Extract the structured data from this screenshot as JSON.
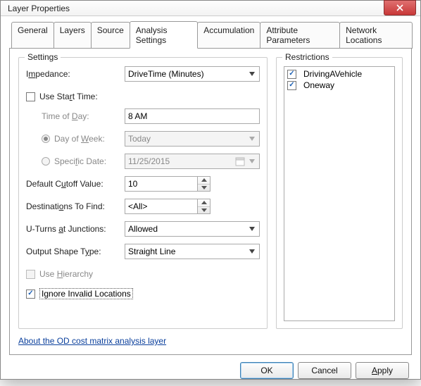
{
  "window": {
    "title": "Layer Properties"
  },
  "tabs": {
    "items": [
      {
        "label": "General"
      },
      {
        "label": "Layers"
      },
      {
        "label": "Source"
      },
      {
        "label": "Analysis Settings"
      },
      {
        "label": "Accumulation"
      },
      {
        "label": "Attribute Parameters"
      },
      {
        "label": "Network Locations"
      }
    ],
    "active_index": 3
  },
  "settings": {
    "legend": "Settings",
    "impedance": {
      "label_pre": "I",
      "label_u": "m",
      "label_post": "pedance:",
      "value": "DriveTime (Minutes)"
    },
    "use_start_time": {
      "label_pre": "Use Sta",
      "label_u": "r",
      "label_post": "t Time:",
      "checked": false
    },
    "time_of_day": {
      "label_pre": "Time of ",
      "label_u": "D",
      "label_post": "ay:",
      "value": "8 AM"
    },
    "day_of_week": {
      "label_pre": "Day of ",
      "label_u": "W",
      "label_post": "eek:",
      "value": "Today",
      "selected": true
    },
    "specific_date": {
      "label_pre": "Speci",
      "label_u": "f",
      "label_post": "ic Date:",
      "value": "11/25/2015",
      "selected": false
    },
    "cutoff": {
      "label_pre": "Default C",
      "label_u": "u",
      "label_post": "toff Value:",
      "value": "10"
    },
    "destinations": {
      "label_pre": "Destinati",
      "label_u": "o",
      "label_post": "ns To Find:",
      "value": "<All>"
    },
    "uturns": {
      "label_pre": "U-Turns ",
      "label_u": "a",
      "label_post": "t Junctions:",
      "value": "Allowed"
    },
    "output_shape": {
      "label_pre": "Output Shape T",
      "label_u": "y",
      "label_post": "pe:",
      "value": "Straight Line"
    },
    "use_hierarchy": {
      "label_pre": "Use ",
      "label_u": "H",
      "label_post": "ierarchy",
      "checked": false
    },
    "ignore_invalid": {
      "label_pre": "I",
      "label_u": "g",
      "label_post": "nore Invalid Locations",
      "checked": true
    }
  },
  "restrictions": {
    "legend": "Restrictions",
    "items": [
      {
        "label": "DrivingAVehicle",
        "checked": true
      },
      {
        "label": "Oneway",
        "checked": true
      }
    ]
  },
  "link": {
    "text": "About the OD cost matrix analysis layer"
  },
  "buttons": {
    "ok": "OK",
    "cancel": "Cancel",
    "apply": "Apply"
  }
}
